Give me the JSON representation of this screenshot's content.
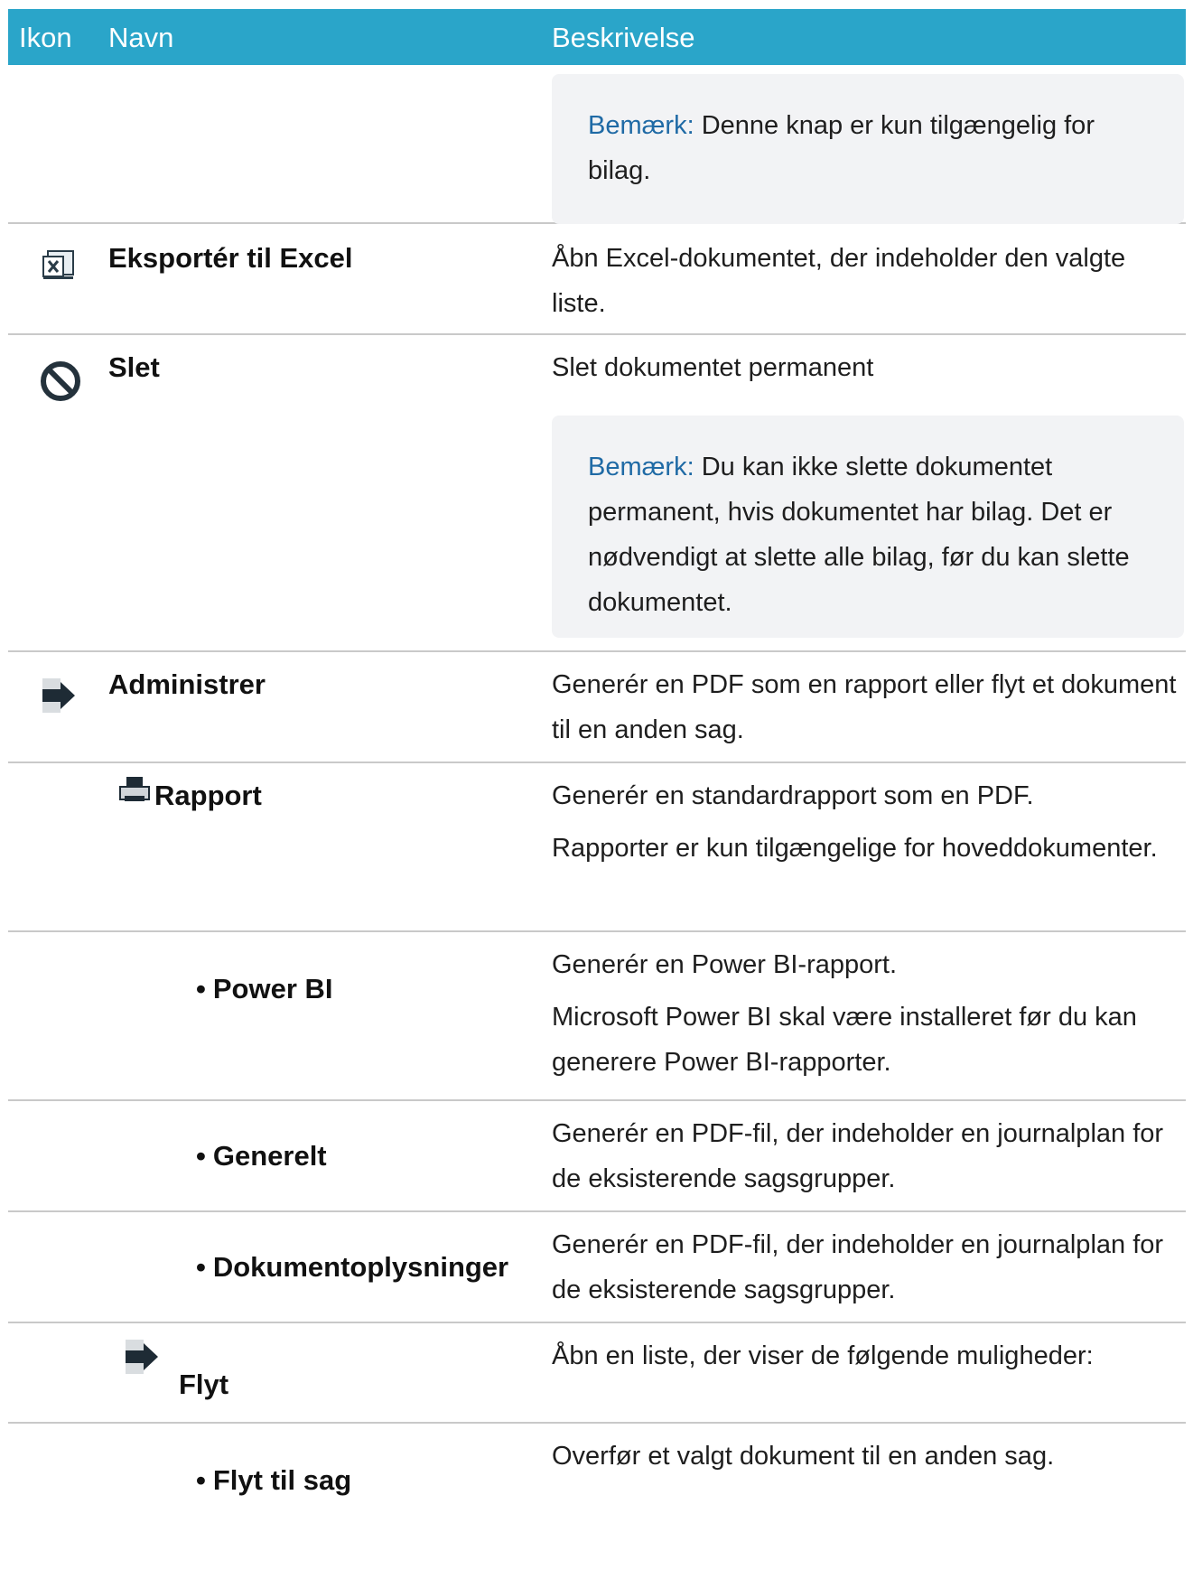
{
  "header": {
    "col_icon": "Ikon",
    "col_name": "Navn",
    "col_desc": "Beskrivelse"
  },
  "note_label": "Bemærk:",
  "rows": {
    "note_top": {
      "note_text": "Denne knap er kun tilgængelig for bilag."
    },
    "export": {
      "icon": "excel-export-icon",
      "name": "Eksportér til Excel",
      "desc": "Åbn Excel-dokumentet, der indeholder den valgte liste."
    },
    "delete": {
      "icon": "prohibited-icon",
      "name": "Slet",
      "desc": "Slet dokumentet permanent",
      "note_text": "Du kan ikke slette dokumentet permanent, hvis dokumentet har bilag. Det er nødvendigt at slette alle bilag, før du kan slette dokumentet."
    },
    "manage": {
      "icon": "arrow-right-icon",
      "name": "Administrer",
      "desc": "Generér en PDF som en rapport eller flyt et dokument til en anden sag."
    },
    "report": {
      "icon": "printer-icon",
      "name": "Rapport",
      "desc1": "Generér en standardrapport som en PDF.",
      "desc2": "Rapporter er kun tilgængelige for hoveddokumenter."
    },
    "powerbi": {
      "name": "Power BI",
      "desc1": "Generér en Power BI-rapport.",
      "desc2": "Microsoft Power BI skal være installeret før du kan generere Power BI-rapporter."
    },
    "general": {
      "name": "Generelt",
      "desc": "Generér en PDF-fil, der indeholder en journalplan for de eksisterende sagsgrupper."
    },
    "docinfo": {
      "name": "Dokumentoplysninger",
      "desc": "Generér en PDF-fil, der indeholder en journalplan for de eksisterende sagsgrupper."
    },
    "move": {
      "icon": "arrow-right-icon",
      "name": "Flyt",
      "desc": "Åbn en liste, der viser de følgende muligheder:"
    },
    "move_case": {
      "name": "Flyt til sag",
      "desc": "Overfør et valgt dokument til en anden sag."
    }
  }
}
